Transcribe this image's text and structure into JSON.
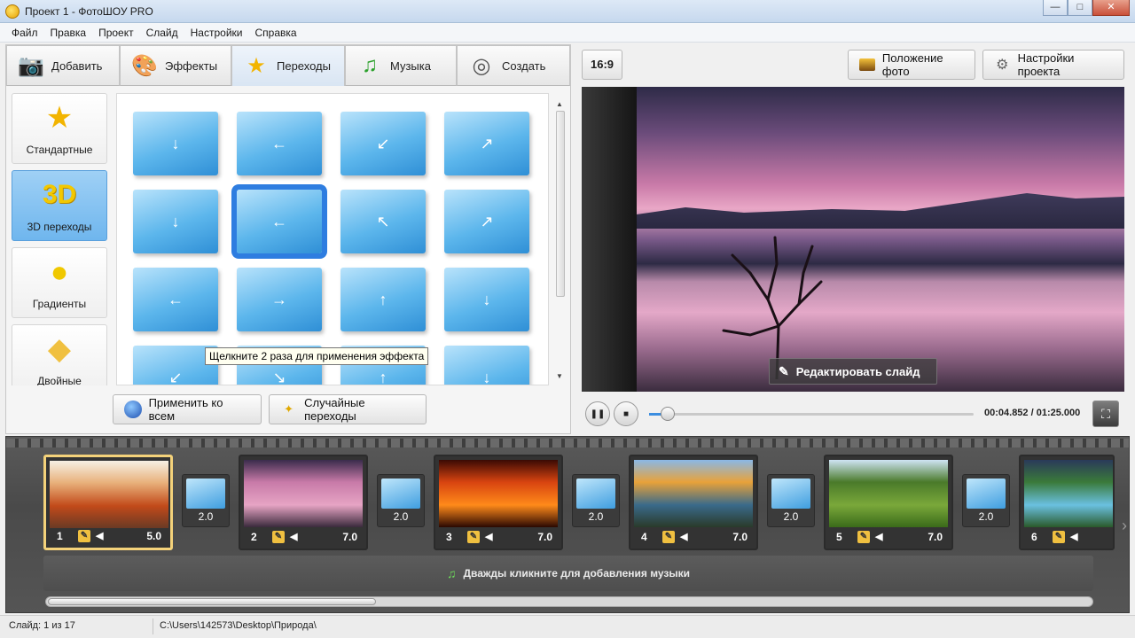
{
  "window": {
    "title": "Проект 1 - ФотоШОУ PRO",
    "buttons": [
      "—",
      "□",
      "✕"
    ]
  },
  "menu": [
    "Файл",
    "Правка",
    "Проект",
    "Слайд",
    "Настройки",
    "Справка"
  ],
  "tabs": [
    {
      "label": "Добавить",
      "icon": "camera-icon"
    },
    {
      "label": "Эффекты",
      "icon": "palette-icon"
    },
    {
      "label": "Переходы",
      "icon": "star-icon",
      "active": true
    },
    {
      "label": "Музыка",
      "icon": "music-note-icon"
    },
    {
      "label": "Создать",
      "icon": "disc-icon"
    }
  ],
  "categories": [
    {
      "label": "Стандартные",
      "icon": "★"
    },
    {
      "label": "3D переходы",
      "icon": "3D",
      "active": true
    },
    {
      "label": "Градиенты",
      "icon": "●"
    },
    {
      "label": "Двойные",
      "icon": "◆"
    }
  ],
  "transitions": [
    {
      "arrow": "↓"
    },
    {
      "arrow": "←"
    },
    {
      "arrow": "↙"
    },
    {
      "arrow": "↗"
    },
    {
      "arrow": "↓"
    },
    {
      "arrow": "←",
      "selected": true
    },
    {
      "arrow": "↖"
    },
    {
      "arrow": "↗"
    },
    {
      "arrow": "←"
    },
    {
      "arrow": "→"
    },
    {
      "arrow": "↑"
    },
    {
      "arrow": "↓"
    },
    {
      "arrow": "↙"
    },
    {
      "arrow": "↘"
    },
    {
      "arrow": "↑"
    },
    {
      "arrow": "↓"
    }
  ],
  "tooltip": "Щелкните 2 раза для применения эффекта",
  "buttons": {
    "apply_all": "Применить ко всем",
    "random": "Случайные переходы"
  },
  "preview": {
    "ratio": "16:9",
    "photo_position": "Положение фото",
    "project_settings": "Настройки проекта",
    "edit_slide": "Редактировать слайд",
    "time": "00:04.852 / 01:25.000",
    "progress": 0.057
  },
  "slides": [
    {
      "num": "1",
      "duration": "5.0",
      "colors": [
        "#f6f0e4",
        "#e8b07a",
        "#c24a1a",
        "#6a3a24"
      ],
      "active": true
    },
    {
      "num": "2",
      "duration": "7.0",
      "colors": [
        "#3a2c4c",
        "#c87aa8",
        "#e6a4c4",
        "#3a2a3c"
      ]
    },
    {
      "num": "3",
      "duration": "7.0",
      "colors": [
        "#3a0a04",
        "#d84410",
        "#ff8a1a",
        "#2a0802"
      ]
    },
    {
      "num": "4",
      "duration": "7.0",
      "colors": [
        "#8ab8e6",
        "#e8a23a",
        "#3a6a8a",
        "#2a3a2a"
      ]
    },
    {
      "num": "5",
      "duration": "7.0",
      "colors": [
        "#cfe4f4",
        "#4a7a2a",
        "#7aa83a",
        "#3a6a1a"
      ]
    },
    {
      "num": "6",
      "duration": "",
      "colors": [
        "#2a3a5a",
        "#3a7a3a",
        "#6ac0e0",
        "#2a5a2a"
      ]
    }
  ],
  "transitions_timeline": [
    "2.0",
    "2.0",
    "2.0",
    "2.0",
    "2.0"
  ],
  "music_hint": "Дважды кликните для добавления музыки",
  "status": {
    "slide": "Слайд: 1 из 17",
    "path": "C:\\Users\\142573\\Desktop\\Природа\\"
  }
}
